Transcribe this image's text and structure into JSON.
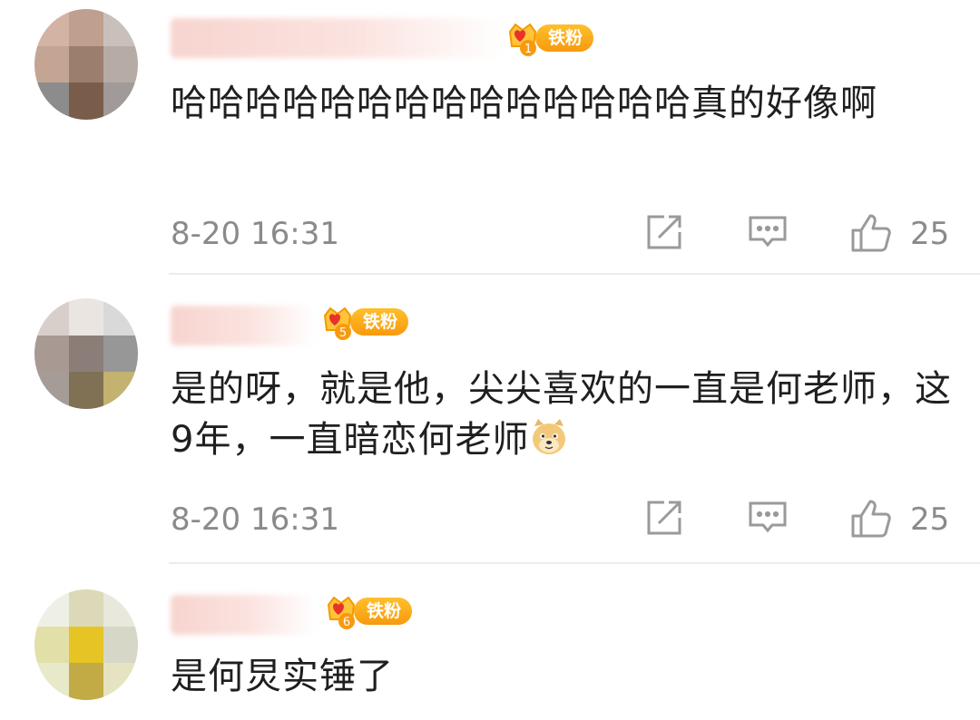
{
  "comments": [
    {
      "badge_level": "1",
      "badge_label": "铁粉",
      "text": "哈哈哈哈哈哈哈哈哈哈哈哈哈哈真的好像啊",
      "time": "8-20 16:31",
      "likes": "25"
    },
    {
      "badge_level": "5",
      "badge_label": "铁粉",
      "text": "是的呀，就是他，尖尖喜欢的一直是何老师，这9年，一直暗恋何老师",
      "time": "8-20 16:31",
      "likes": "25"
    },
    {
      "badge_level": "6",
      "badge_label": "铁粉",
      "text": "是何炅实锤了"
    }
  ],
  "colors": {
    "badge_orange": "#f89a0e",
    "badge_yellow": "#ffbf2b",
    "crown_red": "#e8332a",
    "meta_gray": "#8a8a8a",
    "icon_gray": "#9a9a9a"
  },
  "icons": [
    "repost-icon",
    "comment-icon",
    "like-icon",
    "doge-emoji"
  ]
}
